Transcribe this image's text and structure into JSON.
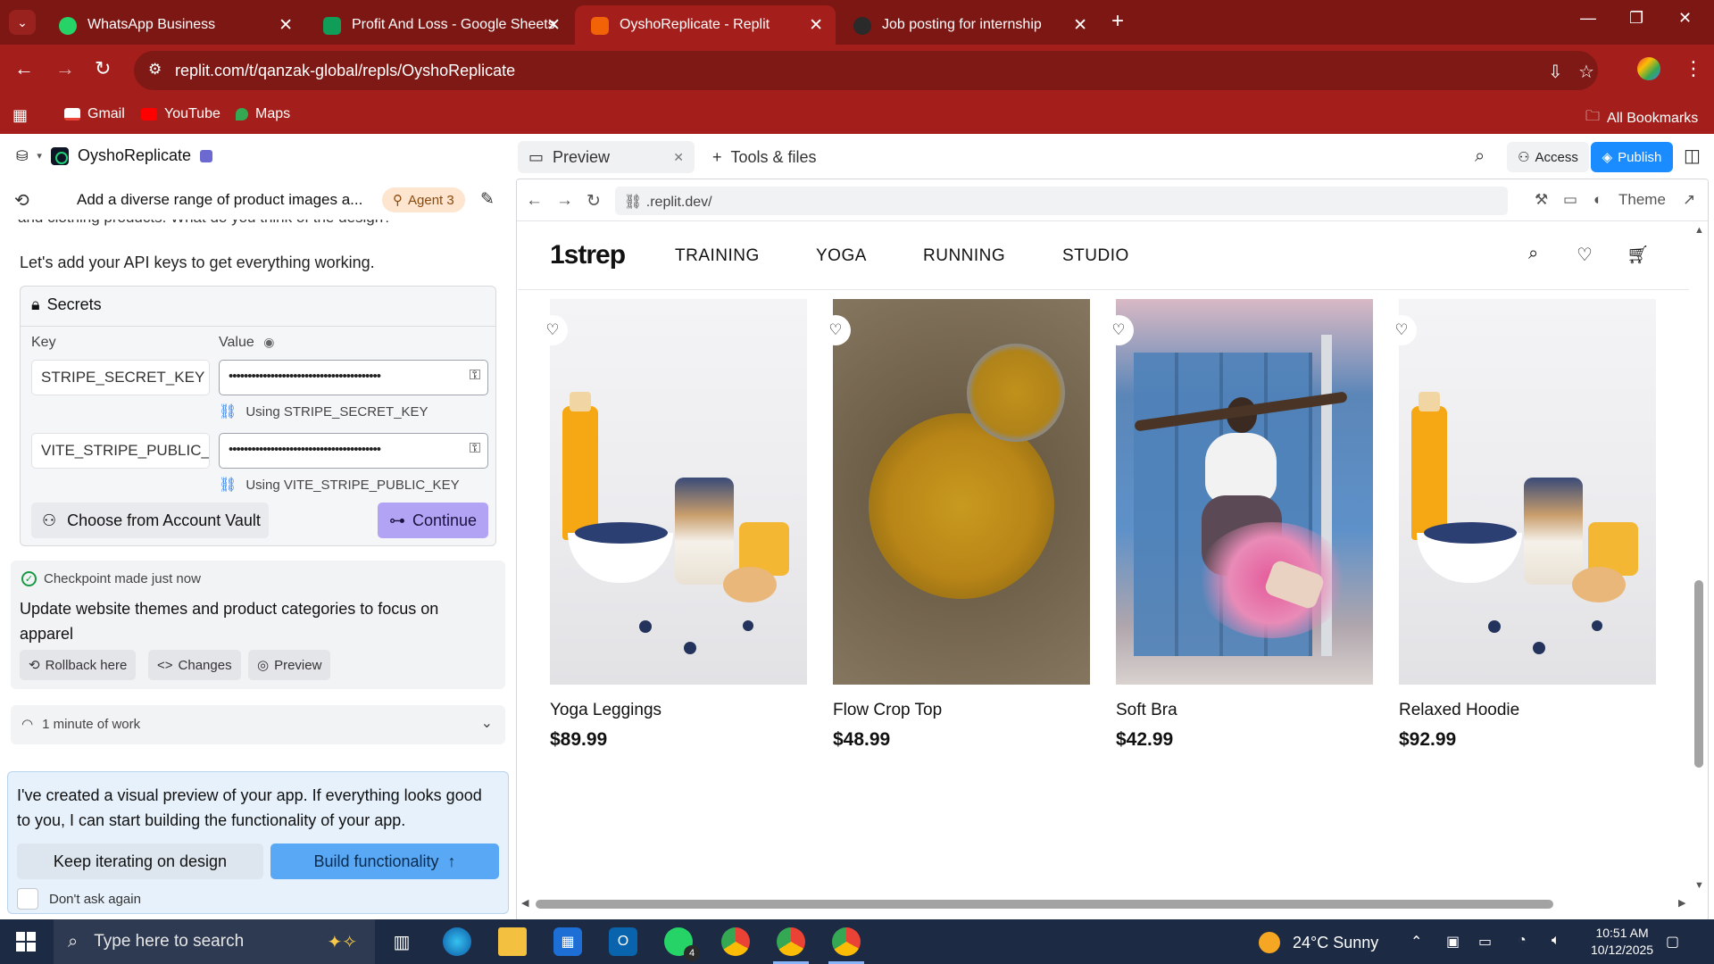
{
  "browser": {
    "tabs": [
      {
        "title": "WhatsApp Business",
        "favicon_color": "#25d366"
      },
      {
        "title": "Profit And Loss - Google Sheets",
        "favicon_color": "#0f9d58"
      },
      {
        "title": "OyshoReplicate - Replit",
        "favicon_color": "#f26207"
      },
      {
        "title": "Job posting for internship",
        "favicon_color": "#2a2a2a"
      }
    ],
    "url": "replit.com/t/qanzak-global/repls/OyshoReplicate",
    "bookmarks": [
      "Gmail",
      "YouTube",
      "Maps"
    ],
    "all_bookmarks": "All Bookmarks",
    "accent": "#a41f1b"
  },
  "replit": {
    "project_name": "OyshoReplicate",
    "tabs": {
      "preview": "Preview",
      "tools": "Tools & files"
    },
    "access_label": "Access",
    "publish_label": "Publish",
    "thread_title": "Add a diverse range of product images a...",
    "agent_badge": "Agent 3",
    "clipped_text": "and clothing products. What do you think of the design?",
    "api_message": "Let's add your API keys to get everything working.",
    "secrets": {
      "title": "Secrets",
      "key_header": "Key",
      "value_header": "Value",
      "rows": [
        {
          "key": "STRIPE_SECRET_KEY",
          "value": "••••••••••••••••••••••••••••••••••••••••",
          "using": "Using STRIPE_SECRET_KEY"
        },
        {
          "key": "VITE_STRIPE_PUBLIC_KEY",
          "value": "••••••••••••••••••••••••••••••••••••••••",
          "using": "Using VITE_STRIPE_PUBLIC_KEY"
        }
      ],
      "vault_button": "Choose from Account Vault",
      "continue_button": "Continue"
    },
    "checkpoint": {
      "status": "Checkpoint made just now",
      "text": "Update website themes and product categories to focus on apparel",
      "rollback": "Rollback here",
      "changes": "Changes",
      "preview": "Preview"
    },
    "work_summary": "1 minute of work",
    "final_message": "I've created a visual preview of your app. If everything looks good to you, I can start building the functionality of your app.",
    "keep_iterating": "Keep iterating on design",
    "build_functionality": "Build functionality",
    "dont_ask": "Don't ask again",
    "preview_url": ".replit.dev/",
    "theme_label": "Theme",
    "publish_color": "#1a8cff"
  },
  "site": {
    "brand": "1strep",
    "menu": [
      "TRAINING",
      "YOGA",
      "RUNNING",
      "STUDIO"
    ],
    "products": [
      {
        "name": "Yoga Leggings",
        "price": "$89.99",
        "image": "breakfast-granola-juice"
      },
      {
        "name": "Flow Crop Top",
        "price": "$48.99",
        "image": "bee-pollen-jar"
      },
      {
        "name": "Soft Bra",
        "price": "$42.99",
        "image": "man-jumping-color-powder"
      },
      {
        "name": "Relaxed Hoodie",
        "price": "$92.99",
        "image": "breakfast-granola-juice"
      }
    ]
  },
  "taskbar": {
    "search_placeholder": "Type here to search",
    "whatsapp_badge": "4",
    "weather": "24°C  Sunny",
    "time": "10:51 AM",
    "date": "10/12/2025"
  }
}
